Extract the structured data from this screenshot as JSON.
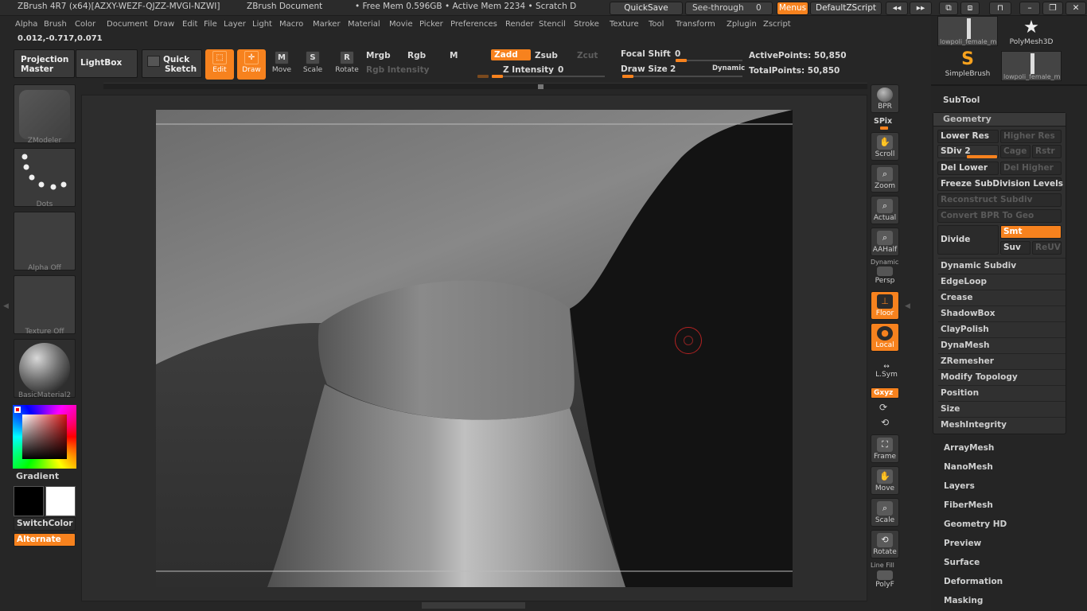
{
  "title": {
    "app": "ZBrush 4R7 (x64)[AZXY-WEZF-QJZZ-MVGI-NZWI]",
    "doc": "ZBrush Document",
    "mem": "• Free Mem 0.596GB • Active Mem 2234 • Scratch D"
  },
  "titlebar_buttons": {
    "quicksave": "QuickSave",
    "seethrough": "See-through",
    "seethrough_val": "0",
    "menus": "Menus",
    "script": "DefaultZScript"
  },
  "menu": [
    "Alpha",
    "Brush",
    "Color",
    "Document",
    "Draw",
    "Edit",
    "File",
    "Layer",
    "Light",
    "Macro",
    "Marker",
    "Material",
    "Movie",
    "Picker",
    "Preferences",
    "Render",
    "Stencil",
    "Stroke",
    "Texture",
    "Tool",
    "Transform",
    "Zplugin",
    "Zscript"
  ],
  "coords": "0.012,-0.717,0.071",
  "shelf": {
    "projection": "Projection Master",
    "lightbox": "LightBox",
    "quicksketch_1": "Quick",
    "quicksketch_2": "Sketch",
    "edit": "Edit",
    "draw": "Draw",
    "move": "Move",
    "scale": "Scale",
    "rotate": "Rotate",
    "mrgb": "Mrgb",
    "rgb": "Rgb",
    "m": "M",
    "rgb_intensity": "Rgb Intensity",
    "zadd": "Zadd",
    "zsub": "Zsub",
    "zcut": "Zcut",
    "z_intensity": "Z Intensity",
    "z_intensity_val": "0",
    "focal": "Focal Shift",
    "focal_val": "0",
    "drawsize": "Draw Size",
    "drawsize_val": "2",
    "dynamic": "Dynamic",
    "active_points": "ActivePoints: 50,850",
    "total_points": "TotalPoints: 50,850"
  },
  "left": {
    "zmodeler": "ZModeler",
    "dots": "Dots",
    "alpha": "Alpha Off",
    "texture": "Texture Off",
    "material": "BasicMaterial2",
    "gradient": "Gradient",
    "switch": "SwitchColor",
    "alternate": "Alternate"
  },
  "rightbar": {
    "bpr": "BPR",
    "spix": "SPix",
    "scroll": "Scroll",
    "zoom": "Zoom",
    "actual": "Actual",
    "aahalf": "AAHalf",
    "dynamic": "Dynamic",
    "persp": "Persp",
    "floor": "Floor",
    "local": "Local",
    "lsym": "L.Sym",
    "xyz": "Gxyz",
    "frame": "Frame",
    "move": "Move",
    "scale": "Scale",
    "rotate": "Rotate",
    "linefill": "Line Fill",
    "polyf": "PolyF"
  },
  "tools": {
    "t1": "lowpoli_female_m",
    "t2": "PolyMesh3D",
    "t3": "SimpleBrush",
    "t4": "lowpoli_female_m"
  },
  "subtool": "SubTool",
  "geometry": {
    "header": "Geometry",
    "lower": "Lower Res",
    "higher": "Higher Res",
    "sdiv": "SDiv 2",
    "cage": "Cage",
    "rstr": "Rstr",
    "dellower": "Del Lower",
    "delhigher": "Del Higher",
    "freeze": "Freeze SubDivision Levels",
    "reconstruct": "Reconstruct Subdiv",
    "convert": "Convert BPR To Geo",
    "divide": "Divide",
    "smt": "Smt",
    "suv": "Suv",
    "reuv": "ReUV"
  },
  "geo_items": [
    "Dynamic Subdiv",
    "EdgeLoop",
    "Crease",
    "ShadowBox",
    "ClayPolish",
    "DynaMesh",
    "ZRemesher",
    "Modify Topology",
    "Position",
    "Size",
    "MeshIntegrity"
  ],
  "tool_menu": [
    "ArrayMesh",
    "NanoMesh",
    "Layers",
    "FiberMesh",
    "Geometry HD",
    "Preview",
    "Surface",
    "Deformation",
    "Masking"
  ],
  "colors": {
    "accent": "#f7821e",
    "bg": "#262626"
  }
}
